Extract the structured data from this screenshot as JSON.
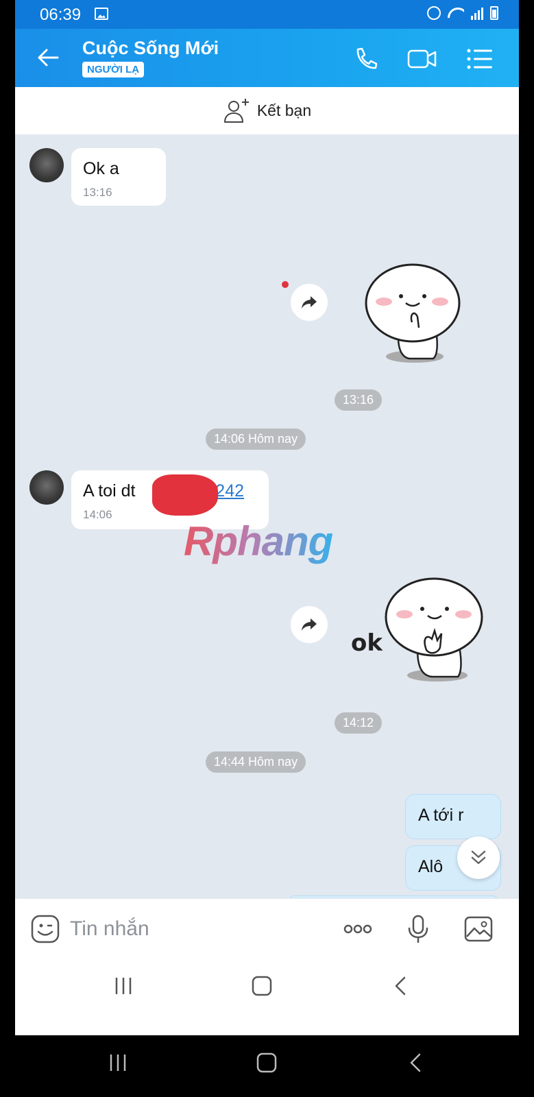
{
  "status_bar": {
    "time": "06:39"
  },
  "header": {
    "title": "Cuộc Sống Mới",
    "badge": "NGƯỜI LẠ"
  },
  "add_friend": {
    "label": "Kết bạn"
  },
  "messages": {
    "m1": {
      "text": "Ok a",
      "time": "13:16"
    },
    "sticker1_time": "13:16",
    "divider1": "14:06 Hôm nay",
    "m2": {
      "text_prefix": "A toi dt ",
      "phone_visible": "9242",
      "time": "14:06"
    },
    "sticker2_text": "ok",
    "sticker2_time": "14:12",
    "divider2": "14:44 Hôm nay",
    "out1": "A tới r",
    "out2": "Alô"
  },
  "watermark": "Rphang",
  "composer": {
    "placeholder": "Tin nhắn"
  },
  "colors": {
    "header_start": "#1a8fe8",
    "header_end": "#20b1f3",
    "chat_bg": "#e2e8ef",
    "outgoing_bubble": "#d5ecfb",
    "link": "#2a7ad0"
  },
  "icons": [
    "back-arrow-icon",
    "phone-icon",
    "video-icon",
    "menu-list-icon",
    "add-user-icon",
    "forward-icon",
    "chevron-double-down-icon",
    "emoji-icon",
    "more-icon",
    "microphone-icon",
    "image-icon"
  ]
}
